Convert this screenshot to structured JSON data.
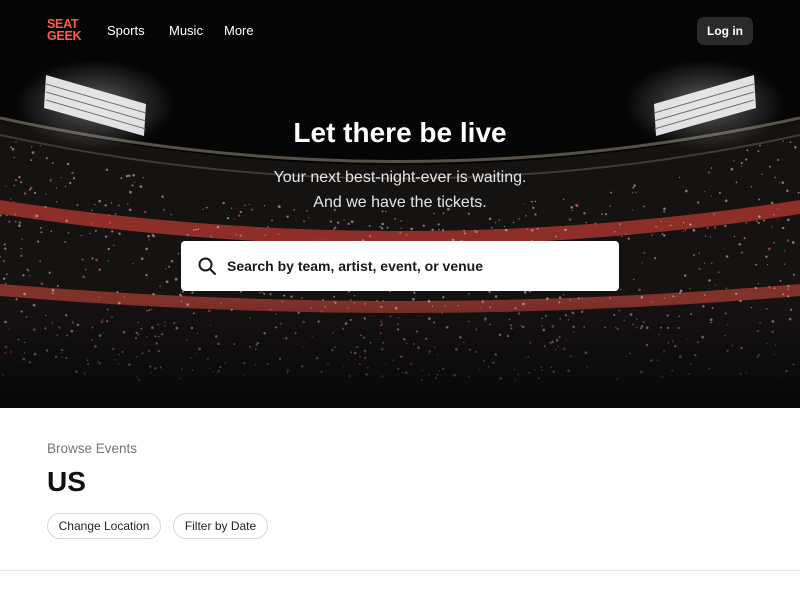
{
  "header": {
    "logo_line1": "SEAT",
    "logo_line2": "GEEK",
    "nav": [
      "Sports",
      "Music",
      "More"
    ],
    "login_label": "Log in"
  },
  "hero": {
    "title": "Let there be live",
    "subtitle_line1": "Your next best-night-ever is waiting.",
    "subtitle_line2": "And we have the tickets.",
    "search_placeholder": "Search by team, artist, event, or venue"
  },
  "browse": {
    "label": "Browse Events",
    "location": "US",
    "buttons": [
      "Change Location",
      "Filter by Date"
    ]
  },
  "colors": {
    "brand": "#ff5b49",
    "hero_bg": "#050505",
    "login_bg": "#2a2a2a"
  }
}
